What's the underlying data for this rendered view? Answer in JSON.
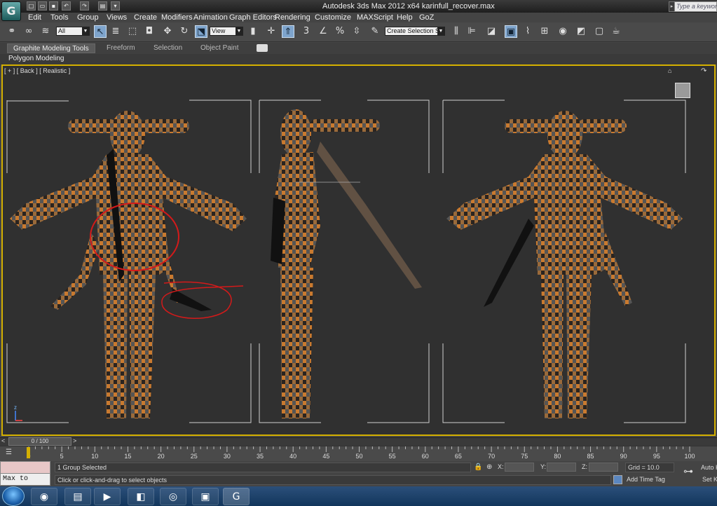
{
  "window": {
    "title": "Autodesk 3ds Max  2012 x64     karinfull_recover.max"
  },
  "search": {
    "placeholder": "Type a keyword or"
  },
  "menu": [
    "Edit",
    "Tools",
    "Group",
    "Views",
    "Create",
    "Modifiers",
    "Animation",
    "Graph Editors",
    "Rendering",
    "Customize",
    "MAXScript",
    "Help",
    "GoZ"
  ],
  "toolbar": {
    "selection_filter": "All",
    "ref_coord": "View",
    "named_selection": "Create Selection Se",
    "snap_angle": "3",
    "snap_percent": "%"
  },
  "ribbon": {
    "tabs": [
      "Graphite Modeling Tools",
      "Freeform",
      "Selection",
      "Object Paint"
    ],
    "panel": "Polygon Modeling"
  },
  "viewport": {
    "label": "[ + ] [ Back ] [ Realistic ]"
  },
  "timeslider": {
    "position": "0 / 100",
    "frame_fraction": 0.0
  },
  "trackbar": {
    "ticks": [
      "0",
      "5",
      "10",
      "15",
      "20",
      "25",
      "30",
      "35",
      "40",
      "45",
      "50",
      "55",
      "60",
      "65",
      "70",
      "75",
      "80",
      "85",
      "90",
      "95",
      "100"
    ]
  },
  "status": {
    "selected": "1 Group Selected",
    "prompt": "Click or click-and-drag to select objects",
    "x_label": "X:",
    "y_label": "Y:",
    "z_label": "Z:",
    "grid": "Grid = 10.0",
    "add_time_tag": "Add Time Tag",
    "autokey": "Auto K",
    "setkey": "Set K",
    "maxscript": "Max to Physc"
  },
  "icons": [
    "3dsmax-logo-icon",
    "new-icon",
    "open-icon",
    "save-icon",
    "undo-icon",
    "redo-icon",
    "select-icon",
    "move-icon",
    "rotate-icon",
    "scale-icon",
    "home-icon"
  ],
  "taskbar": {
    "apps": [
      "windows-explorer",
      "media-player",
      "app-3",
      "chrome",
      "cmd",
      "3dsmax"
    ]
  },
  "colors": {
    "viewport_border": "#d4b000",
    "checker_a": "#c9772b",
    "checker_b": "#222222",
    "annotation": "#d41a1a"
  }
}
